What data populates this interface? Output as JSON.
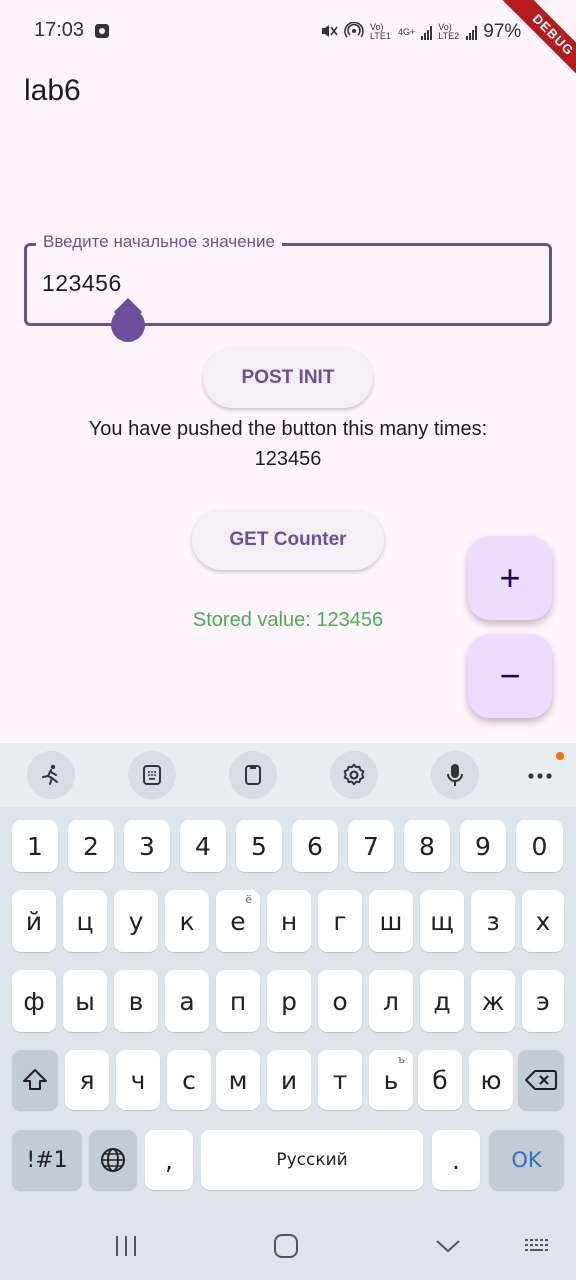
{
  "status": {
    "time": "17:03",
    "battery": "97%",
    "net1": "Vo) LTE1",
    "net2": "4G+",
    "net3": "Vo) LTE2"
  },
  "debug_banner": "DEBUG",
  "app": {
    "title": "lab6",
    "field_label": "Введите начальное значение",
    "field_value": "123456",
    "post_button": "POST INIT",
    "counter_caption": "You have pushed the button this many times:",
    "counter_value": "123456",
    "get_button": "GET Counter",
    "stored_label": "Stored value: ",
    "stored_value": "123456",
    "stored_color": "#4caf50",
    "fab_increment": "+",
    "fab_decrement": "−"
  },
  "keyboard": {
    "toolbar": [
      "sticker-icon",
      "keyboard-mode-icon",
      "clipboard-icon",
      "settings-icon",
      "microphone-icon",
      "more-icon"
    ],
    "rows": [
      [
        "1",
        "2",
        "3",
        "4",
        "5",
        "6",
        "7",
        "8",
        "9",
        "0"
      ],
      [
        "й",
        "ц",
        "у",
        "к",
        "е",
        "н",
        "г",
        "ш",
        "щ",
        "з",
        "х"
      ],
      [
        "ф",
        "ы",
        "в",
        "а",
        "п",
        "р",
        "о",
        "л",
        "д",
        "ж",
        "э"
      ],
      [
        "я",
        "ч",
        "с",
        "м",
        "и",
        "т",
        "ь",
        "б",
        "ю"
      ]
    ],
    "hint_e": "ё",
    "hint_soft": "ъ",
    "symbols": "!#1",
    "comma": ",",
    "space": "Русский",
    "period": ".",
    "ok": "OK"
  },
  "colors": {
    "accent": "#6c4f9c",
    "background": "#fdf6fd",
    "fab": "#eaddff"
  }
}
